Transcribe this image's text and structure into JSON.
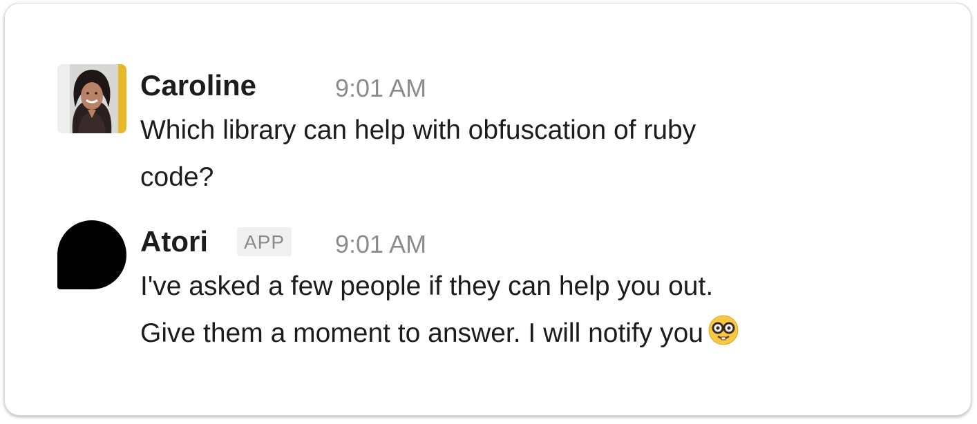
{
  "messages": [
    {
      "author": "Caroline",
      "time": "9:01 AM",
      "text_lines": [
        "Which library can help with obfuscation of ruby",
        "code?"
      ],
      "avatar": "user-photo-avatar"
    },
    {
      "author": "Atori",
      "badge": "APP",
      "time": "9:01 AM",
      "text_lines": [
        "I've asked a few people if they can help you out.",
        "Give them a moment to answer. I will notify you"
      ],
      "emoji": "nerd-face-emoji",
      "avatar": "bot-avatar"
    }
  ],
  "colors": {
    "author_text": "#1d1c1d",
    "timestamp_text": "#8b8b8b",
    "badge_background": "#f0f0f0",
    "badge_text": "#8a8a8a",
    "bot_avatar": "#000000",
    "emoji_face": "#f7c843"
  }
}
